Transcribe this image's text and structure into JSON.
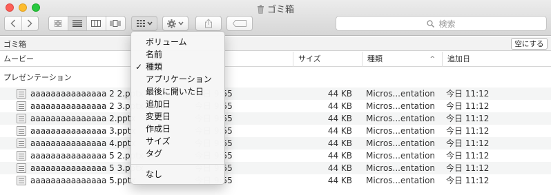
{
  "window": {
    "title": "ゴミ箱"
  },
  "toolbar": {
    "back_icon": "chevron-left-icon",
    "forward_icon": "chevron-right-icon",
    "view_modes": [
      "icon-view",
      "list-view",
      "column-view",
      "cover-flow-view"
    ],
    "active_view": "list-view",
    "arrange_icon": "arrange-grid-icon",
    "action_icon": "gear-icon",
    "share_icon": "share-icon",
    "tag_icon": "tag-icon",
    "search_placeholder": "検索"
  },
  "pathbar": {
    "location": "ゴミ箱",
    "empty_button": "空にする"
  },
  "columns": {
    "name": "ムービー",
    "size": "サイズ",
    "kind": "種類",
    "added": "追加日",
    "sort_indicator": "^"
  },
  "group": {
    "label": "プレゼンテーション"
  },
  "files": [
    {
      "name": "aaaaaaaaaaaaaaa 2 2.pptx",
      "date": "今日 9:55",
      "size": "44 KB",
      "kind": "Micros...entation",
      "added": "今日 11:12"
    },
    {
      "name": "aaaaaaaaaaaaaaa 2 3.pptx",
      "date": "今日 9:55",
      "size": "44 KB",
      "kind": "Micros...entation",
      "added": "今日 11:12"
    },
    {
      "name": "aaaaaaaaaaaaaaa 2.pptx",
      "date": "今日 9:55",
      "size": "44 KB",
      "kind": "Micros...entation",
      "added": "今日 11:12"
    },
    {
      "name": "aaaaaaaaaaaaaaa 3.pptx",
      "date": "今日 9:55",
      "size": "44 KB",
      "kind": "Micros...entation",
      "added": "今日 11:12"
    },
    {
      "name": "aaaaaaaaaaaaaaa 4.pptx",
      "date": "今日 9:55",
      "size": "44 KB",
      "kind": "Micros...entation",
      "added": "今日 11:12"
    },
    {
      "name": "aaaaaaaaaaaaaaa 5 2.pptx",
      "date": "今日 9:55",
      "size": "44 KB",
      "kind": "Micros...entation",
      "added": "今日 11:12"
    },
    {
      "name": "aaaaaaaaaaaaaaa 5 3.pptx",
      "date": "今日 9:55",
      "size": "44 KB",
      "kind": "Micros...entation",
      "added": "今日 11:12"
    },
    {
      "name": "aaaaaaaaaaaaaaa 5.pptx",
      "date": "今日 9:55",
      "size": "44 KB",
      "kind": "Micros...entation",
      "added": "今日 11:12"
    }
  ],
  "arrange_menu": {
    "checked_item": "種類",
    "items": [
      "ボリューム",
      "名前",
      "種類",
      "アプリケーション",
      "最後に開いた日",
      "追加日",
      "変更日",
      "作成日",
      "サイズ",
      "タグ"
    ],
    "none_item": "なし"
  }
}
